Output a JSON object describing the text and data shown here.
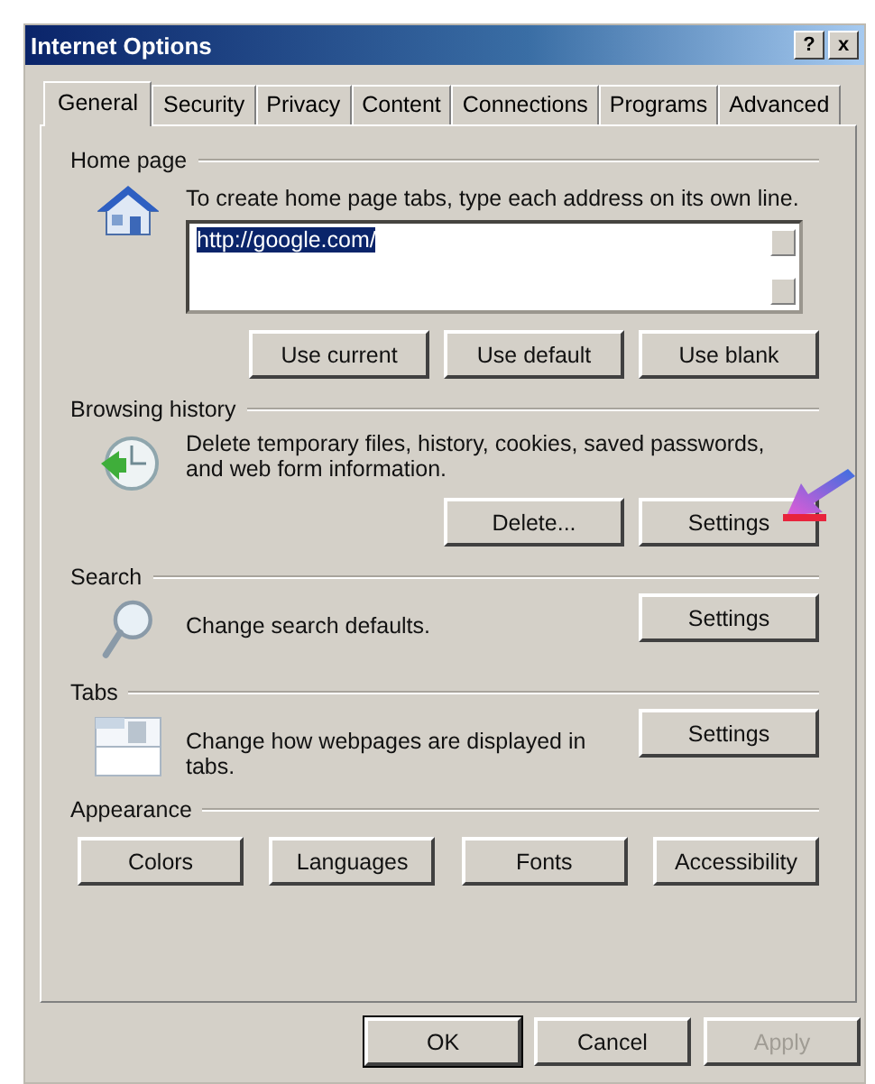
{
  "window": {
    "title": "Internet Options",
    "help_button": "?",
    "close_button": "x"
  },
  "tabs": [
    {
      "label": "General",
      "selected": true
    },
    {
      "label": "Security",
      "selected": false
    },
    {
      "label": "Privacy",
      "selected": false
    },
    {
      "label": "Content",
      "selected": false
    },
    {
      "label": "Connections",
      "selected": false
    },
    {
      "label": "Programs",
      "selected": false
    },
    {
      "label": "Advanced",
      "selected": false
    }
  ],
  "sections": [
    {
      "kind": "home",
      "title": "Home page",
      "description": "To create home page tabs, type each address on its own line.",
      "value": "http://google.com/",
      "buttons": [
        {
          "label": "Use current",
          "disabled": false
        },
        {
          "label": "Use default",
          "disabled": false
        },
        {
          "label": "Use blank",
          "disabled": false
        }
      ]
    },
    {
      "kind": "history",
      "title": "Browsing history",
      "description": "Delete temporary files, history, cookies, saved passwords, and web form information.",
      "buttons": [
        {
          "label": "Delete...",
          "disabled": false
        },
        {
          "label": "Settings",
          "disabled": false,
          "pointer": true
        }
      ]
    },
    {
      "kind": "search",
      "title": "Search",
      "description": "Change search defaults.",
      "buttons": [
        {
          "label": "Settings",
          "disabled": false
        }
      ]
    },
    {
      "kind": "tabs",
      "title": "Tabs",
      "description": "Change how webpages are displayed in tabs.",
      "buttons": [
        {
          "label": "Settings",
          "disabled": false
        }
      ]
    },
    {
      "kind": "appearance",
      "title": "Appearance",
      "buttons": [
        {
          "label": "Colors",
          "disabled": false
        },
        {
          "label": "Languages",
          "disabled": false
        },
        {
          "label": "Fonts",
          "disabled": false
        },
        {
          "label": "Accessibility",
          "disabled": false
        }
      ]
    }
  ],
  "footer_buttons": [
    {
      "label": "OK",
      "disabled": false,
      "default": true
    },
    {
      "label": "Cancel",
      "disabled": false,
      "default": false
    },
    {
      "label": "Apply",
      "disabled": true,
      "default": false
    }
  ]
}
